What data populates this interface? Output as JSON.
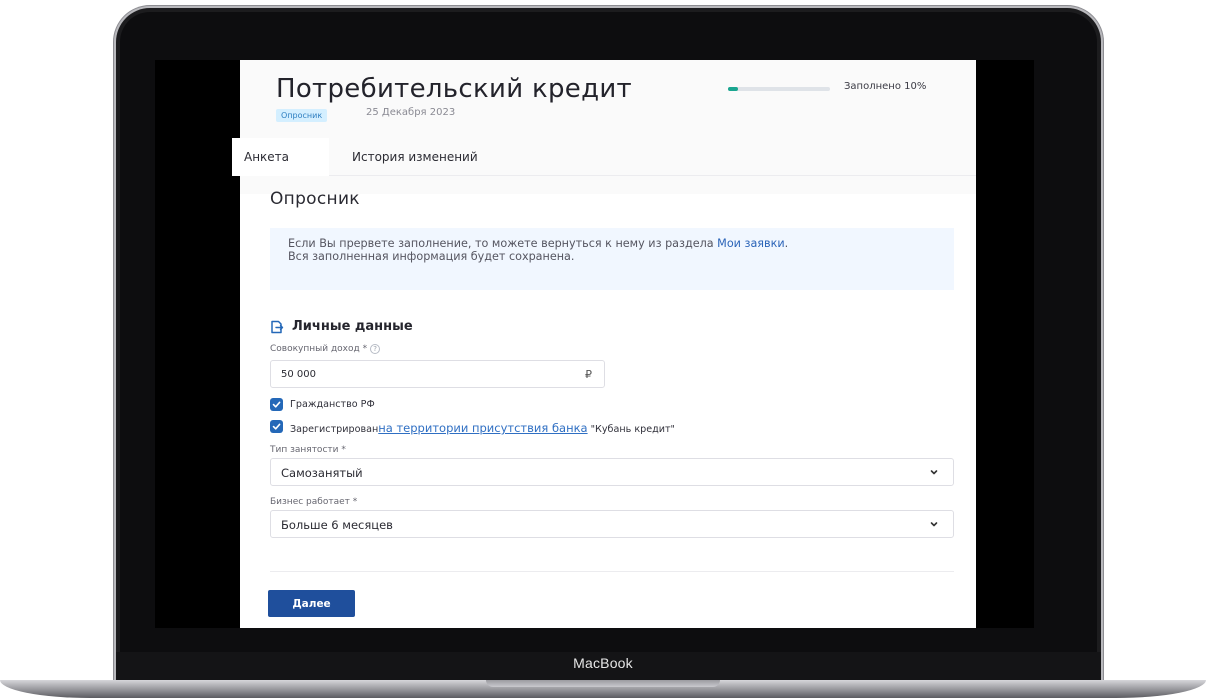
{
  "device": {
    "brand": "MacBook"
  },
  "header": {
    "title": "Потребительский кредит",
    "badge": "Опросник",
    "date": "25 Декабря 2023",
    "progress": {
      "label": "Заполнено 10%",
      "percent": 10
    }
  },
  "tabs": [
    {
      "label": "Анкета",
      "active": true
    },
    {
      "label": "История изменений",
      "active": false
    }
  ],
  "form": {
    "section_title": "Опросник",
    "info": {
      "text_before": "Если Вы прервете заполнение, то можете вернуться к нему из раздела ",
      "link": "Мои заявки",
      "text_after": ".",
      "line2": "Вся заполненная информация будет сохранена."
    },
    "subhead": "Личные данные",
    "income": {
      "label": "Совокупный доход *",
      "help": "?",
      "value": "50 000",
      "currency": "₽"
    },
    "citizenship": {
      "label": "Гражданство РФ",
      "checked": true
    },
    "registered": {
      "label_before": "Зарегистрирован",
      "link": "на территории присутствия банка",
      "label_after": " \"Кубань кредит\"",
      "checked": true
    },
    "employment": {
      "label": "Тип занятости *",
      "value": "Самозанятый"
    },
    "business": {
      "label": "Бизнес работает *",
      "value": "Больше 6 месяцев"
    },
    "next_label": "Далее"
  },
  "colors": {
    "primary": "#1f4f9c",
    "progress": "#1aa690",
    "info_bg": "#f1f7ff",
    "link": "#2b64b8"
  }
}
